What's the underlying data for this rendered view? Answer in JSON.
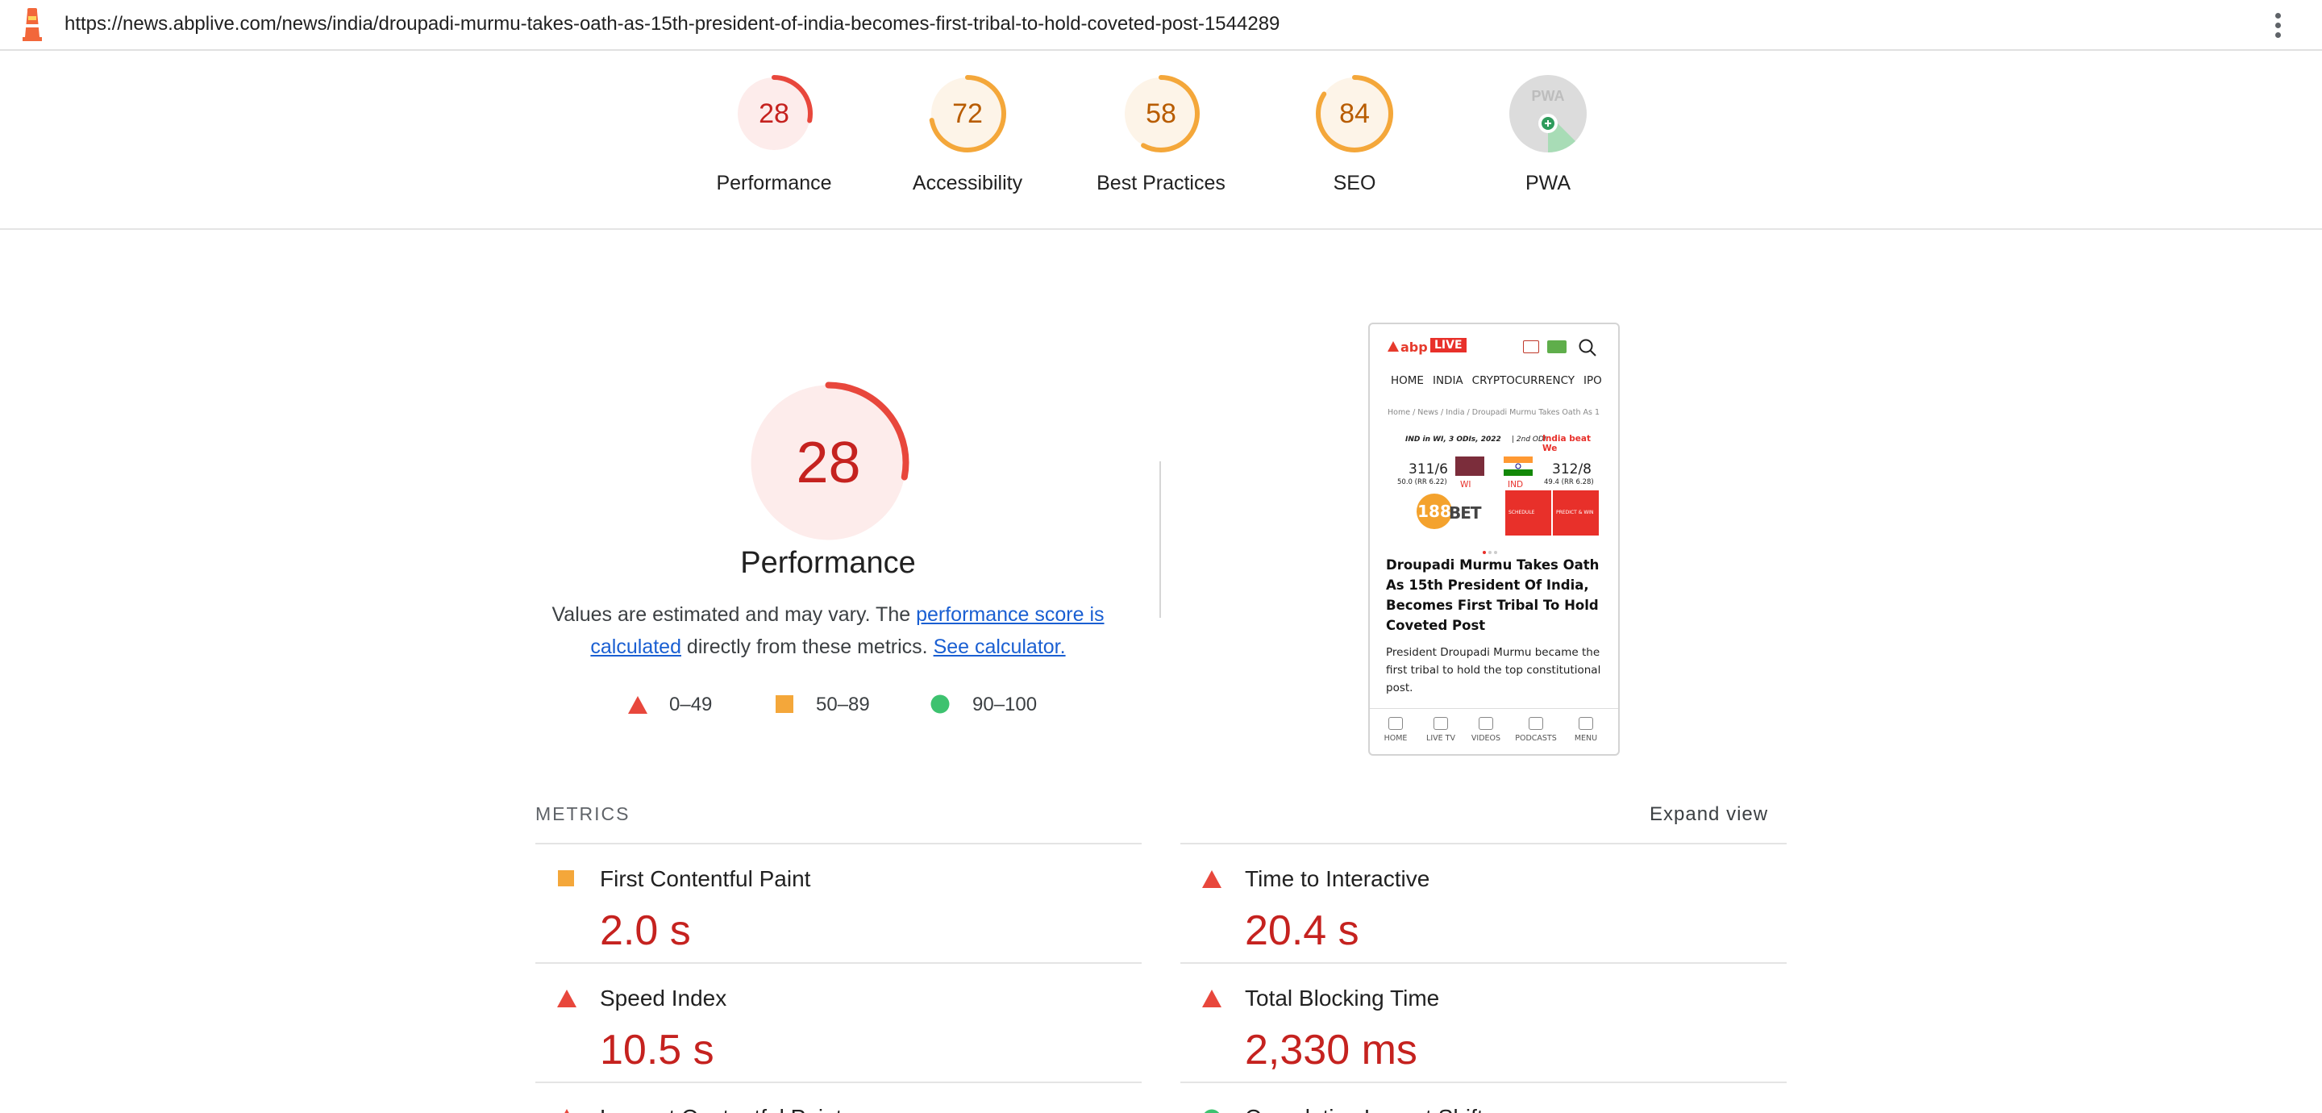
{
  "url_bar": {
    "url": "https://news.abplive.com/news/india/droupadi-murmu-takes-oath-as-15th-president-of-india-becomes-first-tribal-to-hold-coveted-post-1544289"
  },
  "colors": {
    "fail": "#e8473c",
    "fail_text": "#c5221f",
    "average": "#f4a73a",
    "average_text": "#b85c00",
    "pass": "#0cce6b"
  },
  "summary": [
    {
      "label": "Performance",
      "score": "28",
      "fraction": 0.28,
      "rating": "fail"
    },
    {
      "label": "Accessibility",
      "score": "72",
      "fraction": 0.72,
      "rating": "average"
    },
    {
      "label": "Best Practices",
      "score": "58",
      "fraction": 0.58,
      "rating": "average"
    },
    {
      "label": "SEO",
      "score": "84",
      "fraction": 0.84,
      "rating": "average"
    },
    {
      "label": "PWA",
      "score": "",
      "badge_text": "PWA",
      "rating": "pwa"
    }
  ],
  "main": {
    "score": "28",
    "fraction": 0.28,
    "title": "Performance",
    "desc_prefix": "Values are estimated and may vary. The ",
    "desc_link1": "performance score is calculated",
    "desc_mid": " directly from these metrics.",
    "desc_link2": "See calculator."
  },
  "legend": [
    {
      "icon": "triangle-fail-icon",
      "label": "0–49"
    },
    {
      "icon": "square-average-icon",
      "label": "50–89"
    },
    {
      "icon": "circle-pass-icon",
      "label": "90–100"
    }
  ],
  "screenshot": {
    "brand": "abp",
    "live": "LIVE",
    "nav": [
      "HOME",
      "INDIA",
      "CRYPTOCURRENCY",
      "IPO"
    ],
    "crumb": "Home / News / India / Droupadi Murmu Takes Oath As 1",
    "score_head": "IND in WI, 3 ODIs, 2022",
    "score_odi": "| 2nd ODI",
    "score_result": "India beat We",
    "team1_score": "311/6",
    "team1_rr": "50.0 (RR 6.22)",
    "team1": "WI",
    "team2": "IND",
    "team2_score": "312/8",
    "team2_rr": "49.4 (RR 6.28)",
    "ad_num": "188",
    "ad_text": "BET",
    "ad_btn1": "SCHEDULE",
    "ad_btn2": "PREDICT & WIN",
    "headline": "Droupadi Murmu Takes Oath As 15th President Of India, Becomes First Tribal To Hold Coveted Post",
    "subtext": "President Droupadi Murmu became the first tribal to hold the top constitutional post.",
    "bottom_nav": [
      "HOME",
      "LIVE TV",
      "VIDEOS",
      "PODCASTS",
      "MENU"
    ]
  },
  "metrics": {
    "heading": "METRICS",
    "expand": "Expand view",
    "items": [
      {
        "name": "First Contentful Paint",
        "value": "2.0 s",
        "rating": "average"
      },
      {
        "name": "Time to Interactive",
        "value": "20.4 s",
        "rating": "fail"
      },
      {
        "name": "Speed Index",
        "value": "10.5 s",
        "rating": "fail"
      },
      {
        "name": "Total Blocking Time",
        "value": "2,330 ms",
        "rating": "fail"
      },
      {
        "name": "Largest Contentful Paint",
        "value": "",
        "rating": "fail"
      },
      {
        "name": "Cumulative Layout Shift",
        "value": "",
        "rating": "pass"
      }
    ]
  }
}
